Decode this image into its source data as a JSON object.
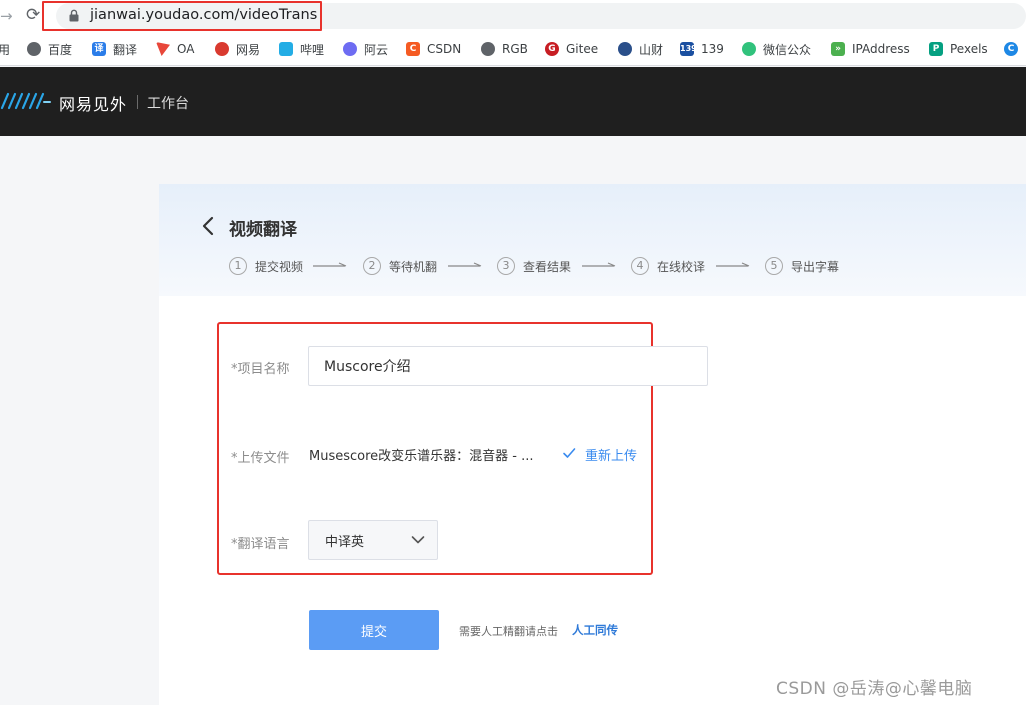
{
  "browser": {
    "url": "jianwai.youdao.com/videoTrans",
    "bookmarks": [
      {
        "label": "用",
        "icon": "bookmark-fragment",
        "color": "#ffffff"
      },
      {
        "label": "百度",
        "icon": "globe-icon",
        "color": "#5f6368"
      },
      {
        "label": "翻译",
        "icon": "youdao-translate-icon",
        "color": "#2b7de9"
      },
      {
        "label": "OA",
        "icon": "flag-icon",
        "color": "#e8473a"
      },
      {
        "label": "网易",
        "icon": "netease-icon",
        "color": "#d93a2f"
      },
      {
        "label": "哔哩",
        "icon": "bilibili-icon",
        "color": "#23ade5"
      },
      {
        "label": "阿云",
        "icon": "aliyun-icon",
        "color": "#6e6cf2"
      },
      {
        "label": "CSDN",
        "icon": "csdn-icon",
        "color": "#f55b23"
      },
      {
        "label": "RGB",
        "icon": "globe-icon",
        "color": "#5f6368"
      },
      {
        "label": "Gitee",
        "icon": "gitee-icon",
        "color": "#c71d23"
      },
      {
        "label": "山财",
        "icon": "university-icon",
        "color": "#2a4f8a"
      },
      {
        "label": "139",
        "icon": "mail-139-icon",
        "color": "#1a4fa0"
      },
      {
        "label": "微信公众",
        "icon": "wechat-icon",
        "color": "#31c27c"
      },
      {
        "label": "IPAddress",
        "icon": "ipaddress-icon",
        "color": "#4cb04f"
      },
      {
        "label": "Pexels",
        "icon": "pexels-icon",
        "color": "#05a081"
      },
      {
        "label": "",
        "icon": "c-logo-icon",
        "color": "#1e88e5"
      }
    ]
  },
  "app": {
    "brand": "网易见外",
    "workspace": "工作台"
  },
  "page": {
    "title": "视频翻译",
    "steps": [
      {
        "num": "1",
        "label": "提交视频"
      },
      {
        "num": "2",
        "label": "等待机翻"
      },
      {
        "num": "3",
        "label": "查看结果"
      },
      {
        "num": "4",
        "label": "在线校译"
      },
      {
        "num": "5",
        "label": "导出字幕"
      }
    ]
  },
  "form": {
    "name_label": "*项目名称",
    "name_value": "Muscore介绍",
    "file_label": "*上传文件",
    "file_name": "Musescore改变乐谱乐器：混音器 - ...",
    "reupload_label": "重新上传",
    "lang_label": "*翻译语言",
    "lang_value": "中译英"
  },
  "actions": {
    "submit_label": "提交",
    "hint_text": "需要人工精翻请点击",
    "hint_link": "人工同传"
  },
  "watermark": "CSDN @岳涛@心馨电脑",
  "colors": {
    "primary": "#5b9cf4",
    "link": "#3a8bef",
    "annotation": "#e8322c",
    "appbar": "#1f1f1f"
  }
}
